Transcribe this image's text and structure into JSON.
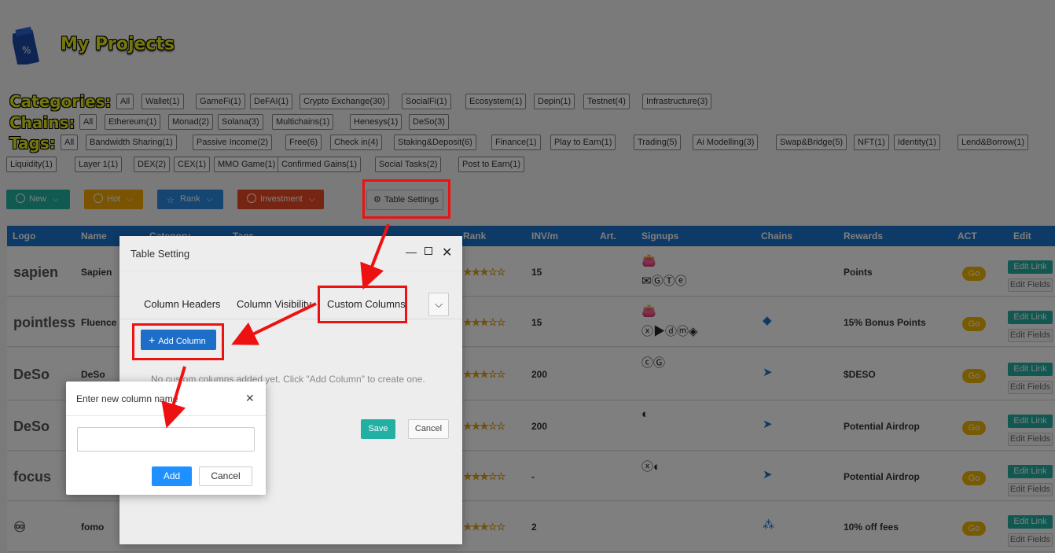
{
  "page_title": "My Projects",
  "logo_glyph": "%",
  "filters": {
    "categories": {
      "label": "Categories:",
      "items": [
        "All",
        "Wallet(1)",
        "GameFi(1)",
        "DeFAI(1)",
        "Crypto Exchange(30)",
        "SocialFi(1)",
        "Ecosystem(1)",
        "Depin(1)",
        "Testnet(4)",
        "Infrastructure(3)"
      ]
    },
    "chains": {
      "label": "Chains:",
      "items": [
        "All",
        "Ethereum(1)",
        "Monad(2)",
        "Solana(3)",
        "Multichains(1)",
        "Henesys(1)",
        "DeSo(3)"
      ]
    },
    "tags": {
      "label": "Tags:",
      "items": [
        "All",
        "Bandwidth Sharing(1)",
        "Passive Income(2)",
        "Free(6)",
        "Check in(4)",
        "Staking&Deposit(6)",
        "Finance(1)",
        "Play to Earn(1)",
        "Trading(5)",
        "Ai Modelling(3)",
        "Swap&Bridge(5)",
        "NFT(1)",
        "Identity(1)",
        "Lend&Borrow(1)",
        "Liquidity(1)",
        "Layer 1(1)",
        "DEX(2)",
        "CEX(1)",
        "MMO Game(1)",
        "Confirmed Gains(1)",
        "Social Tasks(2)",
        "Post to Earn(1)"
      ]
    }
  },
  "toolbar": {
    "new": "New",
    "hot": "Hot",
    "rank": "Rank",
    "investment": "Investment",
    "table_settings": "Table Settings"
  },
  "colors": {
    "new": "#20b4a4",
    "hot": "#f5a800",
    "rank": "#2a8ae6",
    "investment": "#ef4b26",
    "header": "#1b74cf",
    "go": "#f0b400",
    "edit_link": "#21b0a2"
  },
  "table": {
    "headers": [
      "Logo",
      "Name",
      "Category",
      "Tags",
      "Rank",
      "INV/m",
      "Art.",
      "Signups",
      "Chains",
      "Rewards",
      "ACT",
      "Edit"
    ],
    "rows": [
      {
        "logo": "sapien",
        "name": "Sapien",
        "stars": "★★★☆☆",
        "inv": "15",
        "signups1": "👛",
        "signups2": "✉ⒼⓉⓔ",
        "chains": "",
        "rewards": "Points",
        "act": "Go",
        "edit": "Edit Link",
        "fields": "Edit Fields"
      },
      {
        "logo": "pointless",
        "name": "Fluence",
        "stars": "★★★☆☆",
        "inv": "15",
        "signups1": "👛",
        "signups2": "ⓧ▶ⓓⓜ◈",
        "chains": "◆",
        "rewards": "15% Bonus Points",
        "act": "Go",
        "edit": "Edit Link",
        "fields": "Edit Fields"
      },
      {
        "logo": "DeSo",
        "name": "DeSo",
        "stars": "★★★☆☆",
        "inv": "200",
        "signups1": "ⓒⒼ",
        "signups2": "",
        "chains": "➤",
        "rewards": "$DESO",
        "act": "Go",
        "edit": "Edit Link",
        "fields": "Edit Fields"
      },
      {
        "logo": "DeSo",
        "name": "",
        "stars": "★★★☆☆",
        "inv": "200",
        "signups1": "◐",
        "signups2": "",
        "chains": "➤",
        "rewards": "Potential Airdrop",
        "act": "Go",
        "edit": "Edit Link",
        "fields": "Edit Fields"
      },
      {
        "logo": "focus",
        "name": "",
        "stars": "★★★☆☆",
        "inv": "-",
        "signups1": "ⓧ◐",
        "signups2": "",
        "chains": "➤",
        "rewards": "Potential Airdrop",
        "act": "Go",
        "edit": "Edit Link",
        "fields": "Edit Fields"
      },
      {
        "logo": "♾",
        "name": "fomo",
        "stars": "★★★☆☆",
        "inv": "2",
        "signups1": "",
        "signups2": "",
        "chains": "⁂",
        "rewards": "10% off fees",
        "act": "Go",
        "edit": "Edit Link",
        "fields": "Edit Fields"
      }
    ]
  },
  "table_setting_dialog": {
    "title": "Table Setting",
    "tabs": [
      "Column Headers",
      "Column Visibility",
      "Custom Columns"
    ],
    "add_column": "Add Column",
    "empty_text": "No custom columns added yet. Click \"Add Column\" to create one.",
    "save": "Save",
    "cancel": "Cancel"
  },
  "column_name_dialog": {
    "title": "Enter new column name",
    "input_value": "",
    "add": "Add",
    "cancel": "Cancel"
  }
}
